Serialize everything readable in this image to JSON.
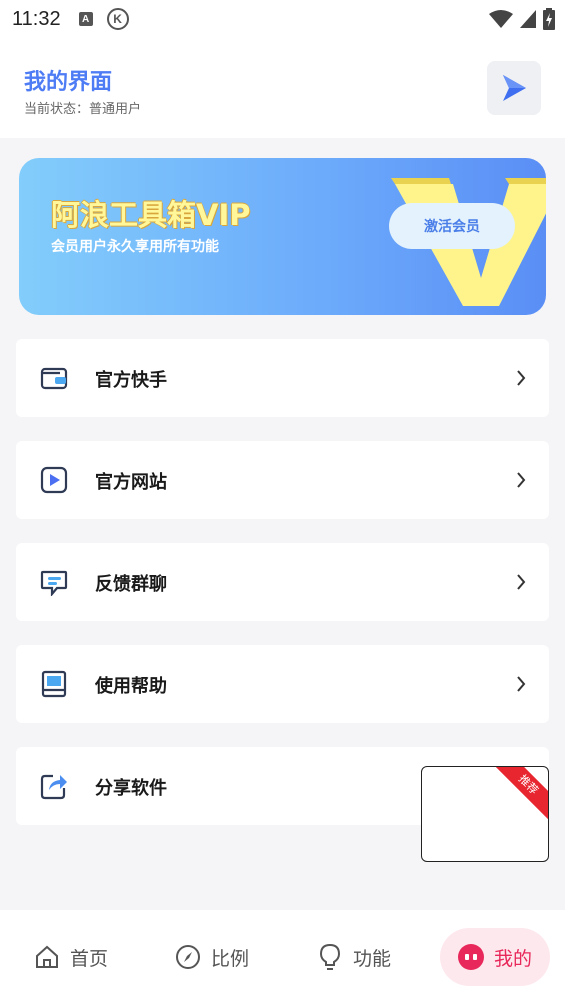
{
  "status_bar": {
    "time": "11:32",
    "icon_a": "A",
    "icon_k": "K"
  },
  "header": {
    "title": "我的界面",
    "status": "当前状态：普通用户",
    "play_icon": "play-icon"
  },
  "vip_banner": {
    "title": "阿浪工具箱VIP",
    "subtitle": "会员用户永久享用所有功能",
    "activate_label": "激活会员",
    "badge_letter": "V"
  },
  "menu": [
    {
      "label": "官方快手",
      "icon": "wallet-icon"
    },
    {
      "label": "官方网站",
      "icon": "video-icon"
    },
    {
      "label": "反馈群聊",
      "icon": "chat-icon"
    },
    {
      "label": "使用帮助",
      "icon": "book-icon"
    },
    {
      "label": "分享软件",
      "icon": "share-icon"
    }
  ],
  "recommend_badge": "推荐",
  "bottom_nav": [
    {
      "label": "首页",
      "icon": "home-icon"
    },
    {
      "label": "比例",
      "icon": "compass-icon"
    },
    {
      "label": "功能",
      "icon": "bulb-icon"
    },
    {
      "label": "我的",
      "icon": "face-icon",
      "active": true
    }
  ],
  "colors": {
    "accent": "#4d7cf5",
    "active_tab": "#e8285a",
    "vip_gold": "#fff79a"
  }
}
